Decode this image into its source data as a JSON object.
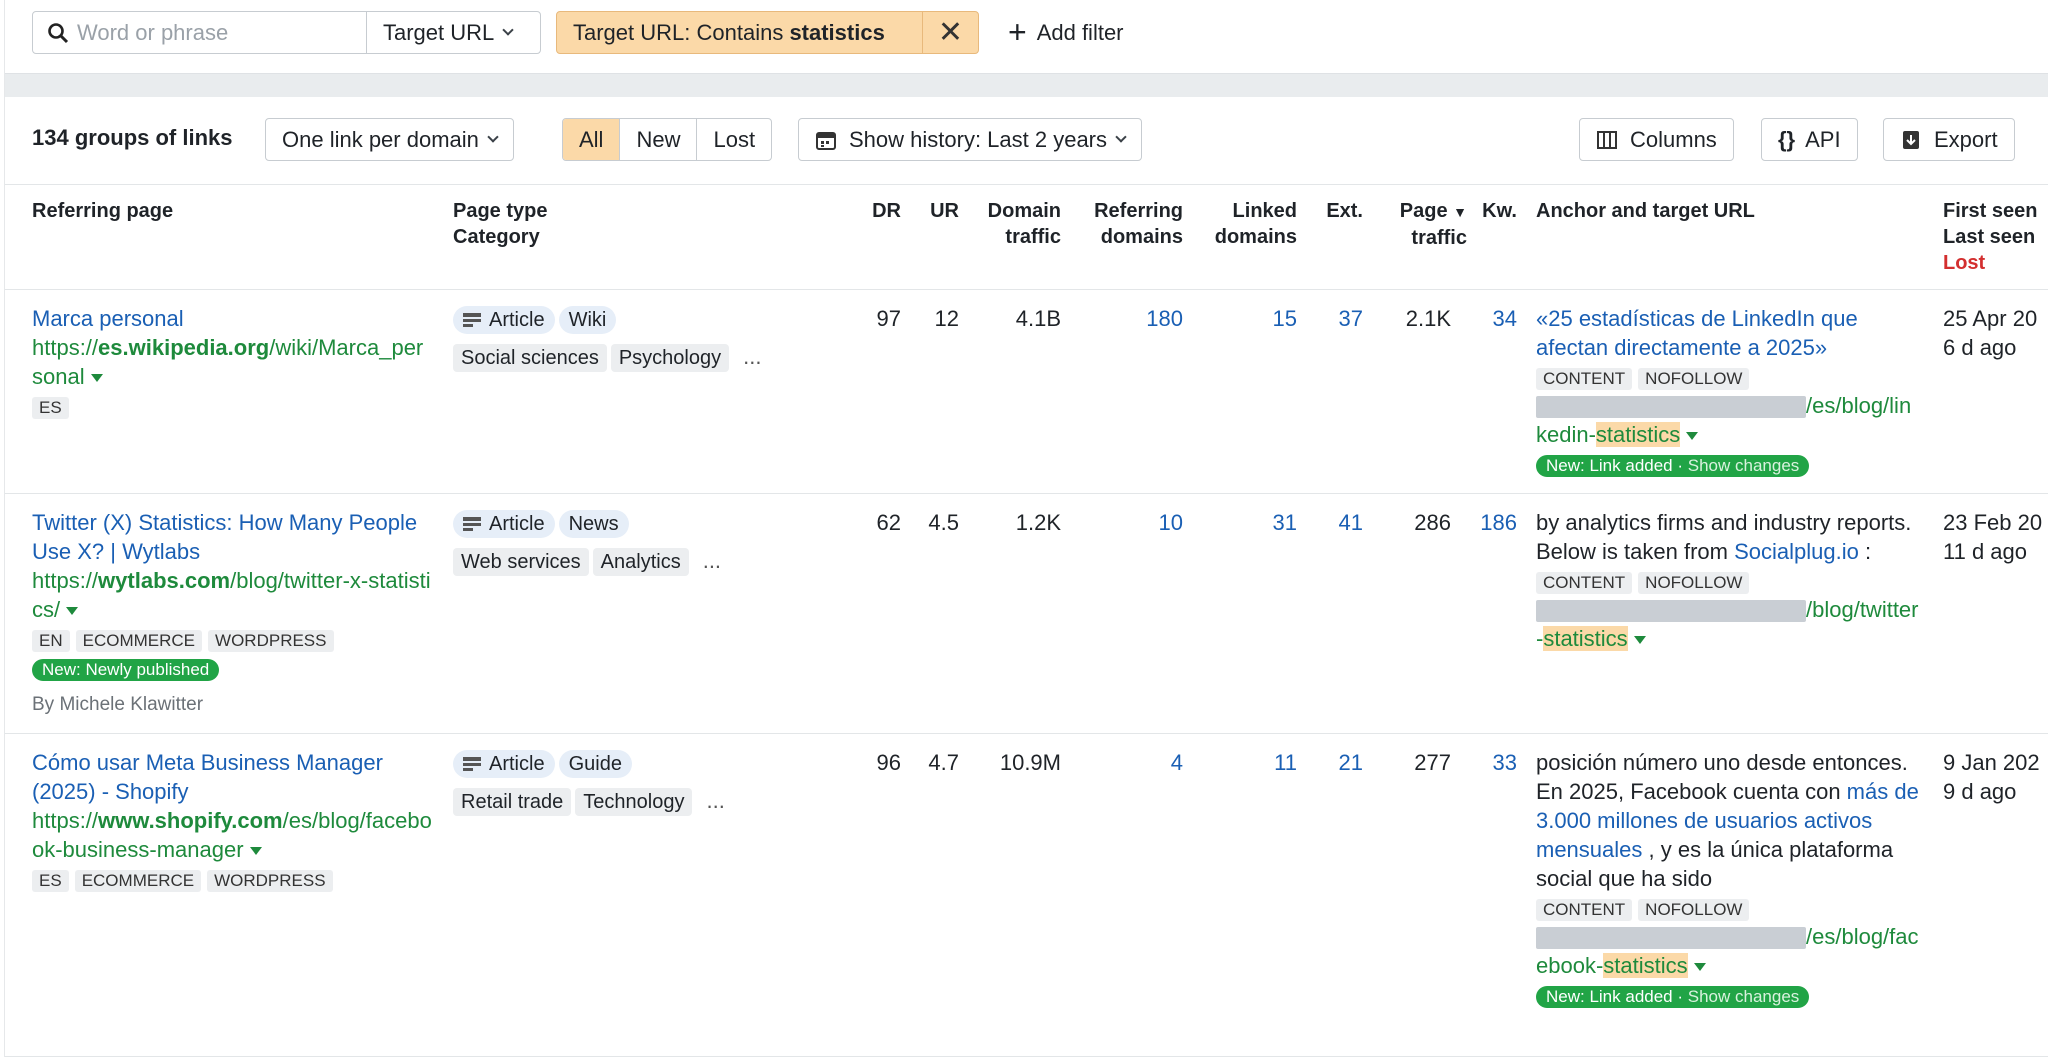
{
  "filter_bar": {
    "search_placeholder": "Word or phrase",
    "target_url_label": "Target URL",
    "active_filter_prefix": "Target URL: Contains ",
    "active_filter_value": "statistics",
    "add_filter_label": "Add filter"
  },
  "toolbar": {
    "count": "134 groups of links",
    "grouping": "One link per domain",
    "segments": [
      "All",
      "New",
      "Lost"
    ],
    "active_segment": "All",
    "history": "Show history: Last 2 years",
    "columns": "Columns",
    "api": "API",
    "export": "Export"
  },
  "columns": {
    "referring_page": "Referring page",
    "page_type": "Page type",
    "category": "Category",
    "dr": "DR",
    "ur": "UR",
    "domain_traffic_1": "Domain",
    "domain_traffic_2": "traffic",
    "ref_domains_1": "Referring",
    "ref_domains_2": "domains",
    "linked_domains_1": "Linked",
    "linked_domains_2": "domains",
    "ext": "Ext.",
    "page_traffic_1": "Page",
    "page_traffic_2": "traffic",
    "kw": "Kw.",
    "anchor": "Anchor and target URL",
    "first_seen": "First seen",
    "last_seen": "Last seen",
    "lost": "Lost"
  },
  "rows": [
    {
      "title": "Marca personal",
      "url_pre": "https://",
      "url_domain": "es.wikipedia.org",
      "url_path": "/wiki/Marca_personal",
      "tags": [
        "ES"
      ],
      "badge": "",
      "author": "",
      "page_type": "Article",
      "type2": "Wiki",
      "categories": [
        "Social sciences",
        "Psychology"
      ],
      "more": "...",
      "dr": "97",
      "ur": "12",
      "domain_traffic": "4.1B",
      "ref_domains": "180",
      "linked_domains": "15",
      "ext": "37",
      "page_traffic": "2.1K",
      "kw": "34",
      "anchor_pre": "",
      "anchor_link": "«25 estadísticas de LinkedIn que afectan directamente a 2025»",
      "anchor_post": "",
      "link_tags": [
        "CONTENT",
        "NOFOLLOW"
      ],
      "target_path": "/es/blog/linkedin-",
      "target_hl": "statistics",
      "status": "New: Link added · ",
      "status_action": "Show changes",
      "first_seen": "25 Apr 20",
      "last_seen": "6 d ago"
    },
    {
      "title": "Twitter (X) Statistics: How Many People Use X? | Wytlabs",
      "url_pre": "https://",
      "url_domain": "wytlabs.com",
      "url_path": "/blog/twitter-x-statistics/",
      "tags": [
        "EN",
        "ECOMMERCE",
        "WORDPRESS"
      ],
      "badge": "New: Newly published",
      "author": "By Michele Klawitter",
      "page_type": "Article",
      "type2": "News",
      "categories": [
        "Web services",
        "Analytics"
      ],
      "more": "...",
      "dr": "62",
      "ur": "4.5",
      "domain_traffic": "1.2K",
      "ref_domains": "10",
      "linked_domains": "31",
      "ext": "41",
      "page_traffic": "286",
      "kw": "186",
      "anchor_pre": "by analytics firms and industry reports. Below is taken from ",
      "anchor_link": "Socialplug.io",
      "anchor_post": " :",
      "link_tags": [
        "CONTENT",
        "NOFOLLOW"
      ],
      "target_path": "/blog/twitter-",
      "target_hl": "statistics",
      "status": "",
      "status_action": "",
      "first_seen": "23 Feb 20",
      "last_seen": "11 d ago"
    },
    {
      "title": "Cómo usar Meta Business Manager (2025) - Shopify",
      "url_pre": "https://",
      "url_domain": "www.shopify.com",
      "url_path": "/es/blog/facebook-business-manager",
      "tags": [
        "ES",
        "ECOMMERCE",
        "WORDPRESS"
      ],
      "badge": "",
      "author": "",
      "page_type": "Article",
      "type2": "Guide",
      "categories": [
        "Retail trade",
        "Technology"
      ],
      "more": "...",
      "dr": "96",
      "ur": "4.7",
      "domain_traffic": "10.9M",
      "ref_domains": "4",
      "linked_domains": "11",
      "ext": "21",
      "page_traffic": "277",
      "kw": "33",
      "anchor_pre": "posición número uno desde entonces. En 2025, Facebook cuenta con ",
      "anchor_link": "más de 3.000 millones de usuarios activos mensuales",
      "anchor_post": " , y es la única plataforma social que ha sido",
      "link_tags": [
        "CONTENT",
        "NOFOLLOW"
      ],
      "target_path": "/es/blog/facebook-",
      "target_hl": "statistics",
      "status": "New: Link added · ",
      "status_action": "Show changes",
      "first_seen": "9 Jan 202",
      "last_seen": "9 d ago"
    }
  ]
}
